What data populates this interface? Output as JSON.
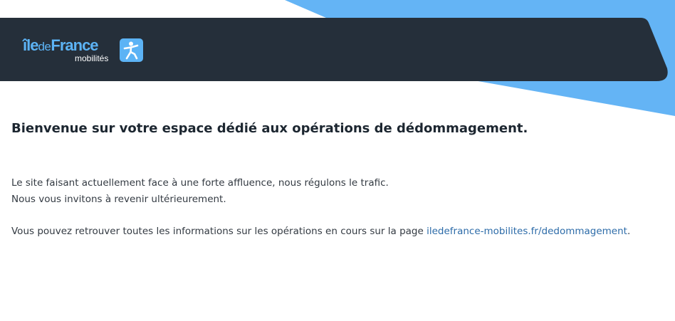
{
  "colors": {
    "header_background": "#252f3a",
    "accent_blue": "#64b4f5",
    "logo_blue": "#5cb3f5",
    "link": "#2c6ba8",
    "text": "#333a42"
  },
  "header": {
    "logo": {
      "wordmark_prefix": "île",
      "wordmark_de": "de",
      "wordmark_suffix": "France",
      "subtitle": "mobilités",
      "icon": "walking-person-icon"
    }
  },
  "main": {
    "title": "Bienvenue sur votre espace dédié aux opérations de dédommagement.",
    "line1": "Le site faisant actuellement face à une forte affluence, nous régulons le trafic.",
    "line2": "Nous vous invitons à revenir ultérieurement.",
    "info_prefix": "Vous pouvez retrouver toutes les informations sur les opérations en cours sur la page ",
    "info_link": "iledefrance-mobilites.fr/dedommagement",
    "info_suffix": "."
  }
}
